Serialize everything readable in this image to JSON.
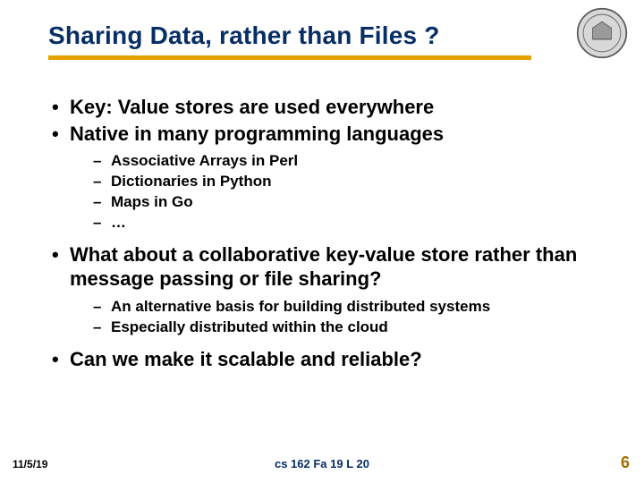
{
  "title": "Sharing Data, rather than Files ?",
  "seal_name": "university-seal-icon",
  "bullets": [
    {
      "text": "Key: Value stores are used everywhere",
      "sub": []
    },
    {
      "text": "Native in many programming languages",
      "sub": [
        "Associative Arrays in Perl",
        "Dictionaries in Python",
        "Maps in Go",
        "…"
      ]
    },
    {
      "text": "What about a collaborative key-value store rather than message passing or file sharing?",
      "sub": [
        "An alternative basis for building distributed systems",
        "Especially distributed within the cloud"
      ]
    },
    {
      "text": "Can we make it scalable and reliable?",
      "sub": []
    }
  ],
  "footer": {
    "date": "11/5/19",
    "center": "cs 162 Fa 19 L 20",
    "page": "6"
  }
}
